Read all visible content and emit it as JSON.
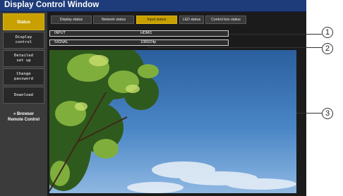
{
  "window": {
    "title": "Display Control Window"
  },
  "sidebar": {
    "items": [
      {
        "label": "Status",
        "active": true
      },
      {
        "label": "Display\ncontrol"
      },
      {
        "label": "Detailed\nset up"
      },
      {
        "label": "Change\npassword"
      },
      {
        "label": "Download"
      }
    ],
    "browser_line1": "» Browser",
    "browser_line2": "Remote Control"
  },
  "tabs": [
    {
      "label": "Display status"
    },
    {
      "label": "Network status"
    },
    {
      "label": "Input status",
      "active": true
    },
    {
      "label": "LED status"
    },
    {
      "label": "Control box status"
    }
  ],
  "status": {
    "input_label": "INPUT",
    "input_value": "HDMI1",
    "signal_label": "SIGNAL",
    "signal_value": "1080/24p"
  },
  "callouts": [
    "1",
    "2",
    "3"
  ],
  "colors": {
    "accent": "#c8a000",
    "titlebar": "#1f3c7a",
    "sidebar": "#3b3b3b"
  }
}
